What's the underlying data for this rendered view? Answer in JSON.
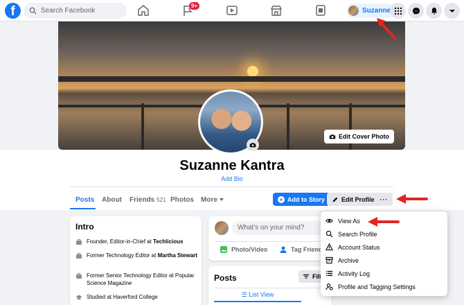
{
  "topbar": {
    "search_placeholder": "Search Facebook",
    "notification_badge": "9+",
    "profile_name": "Suzanne"
  },
  "cover": {
    "edit_cover_label": "Edit Cover Photo"
  },
  "profile": {
    "name": "Suzanne Kantra",
    "add_bio": "Add Bio"
  },
  "tabs": [
    {
      "label": "Posts"
    },
    {
      "label": "About"
    },
    {
      "label": "Friends",
      "count": "521"
    },
    {
      "label": "Photos"
    },
    {
      "label": "More"
    }
  ],
  "actions": {
    "add_to_story": "Add to Story",
    "edit_profile": "Edit Profile",
    "more": "···"
  },
  "intro": {
    "title": "Intro",
    "items": [
      {
        "text": "Founder, Editor-in-Chief at ",
        "bold": "Techlicious"
      },
      {
        "text": "Former Technology Editor at ",
        "bold": "Martha Stewart"
      },
      {
        "text": "Former Senior Technology Editor at Popular Science Magazine",
        "bold": ""
      },
      {
        "text": "Studied at Haverford College",
        "bold": ""
      }
    ]
  },
  "composer": {
    "placeholder": "What's on your mind?",
    "photo_video": "Photo/Video",
    "tag_friends": "Tag Friends"
  },
  "posts": {
    "title": "Posts",
    "filter": "Filte",
    "list_view": "List View"
  },
  "menu": {
    "items": [
      "View As",
      "Search Profile",
      "Account Status",
      "Archive",
      "Activity Log",
      "Profile and Tagging Settings"
    ]
  },
  "colors": {
    "brand": "#1877f2",
    "annotation_arrow": "#e4241f"
  }
}
